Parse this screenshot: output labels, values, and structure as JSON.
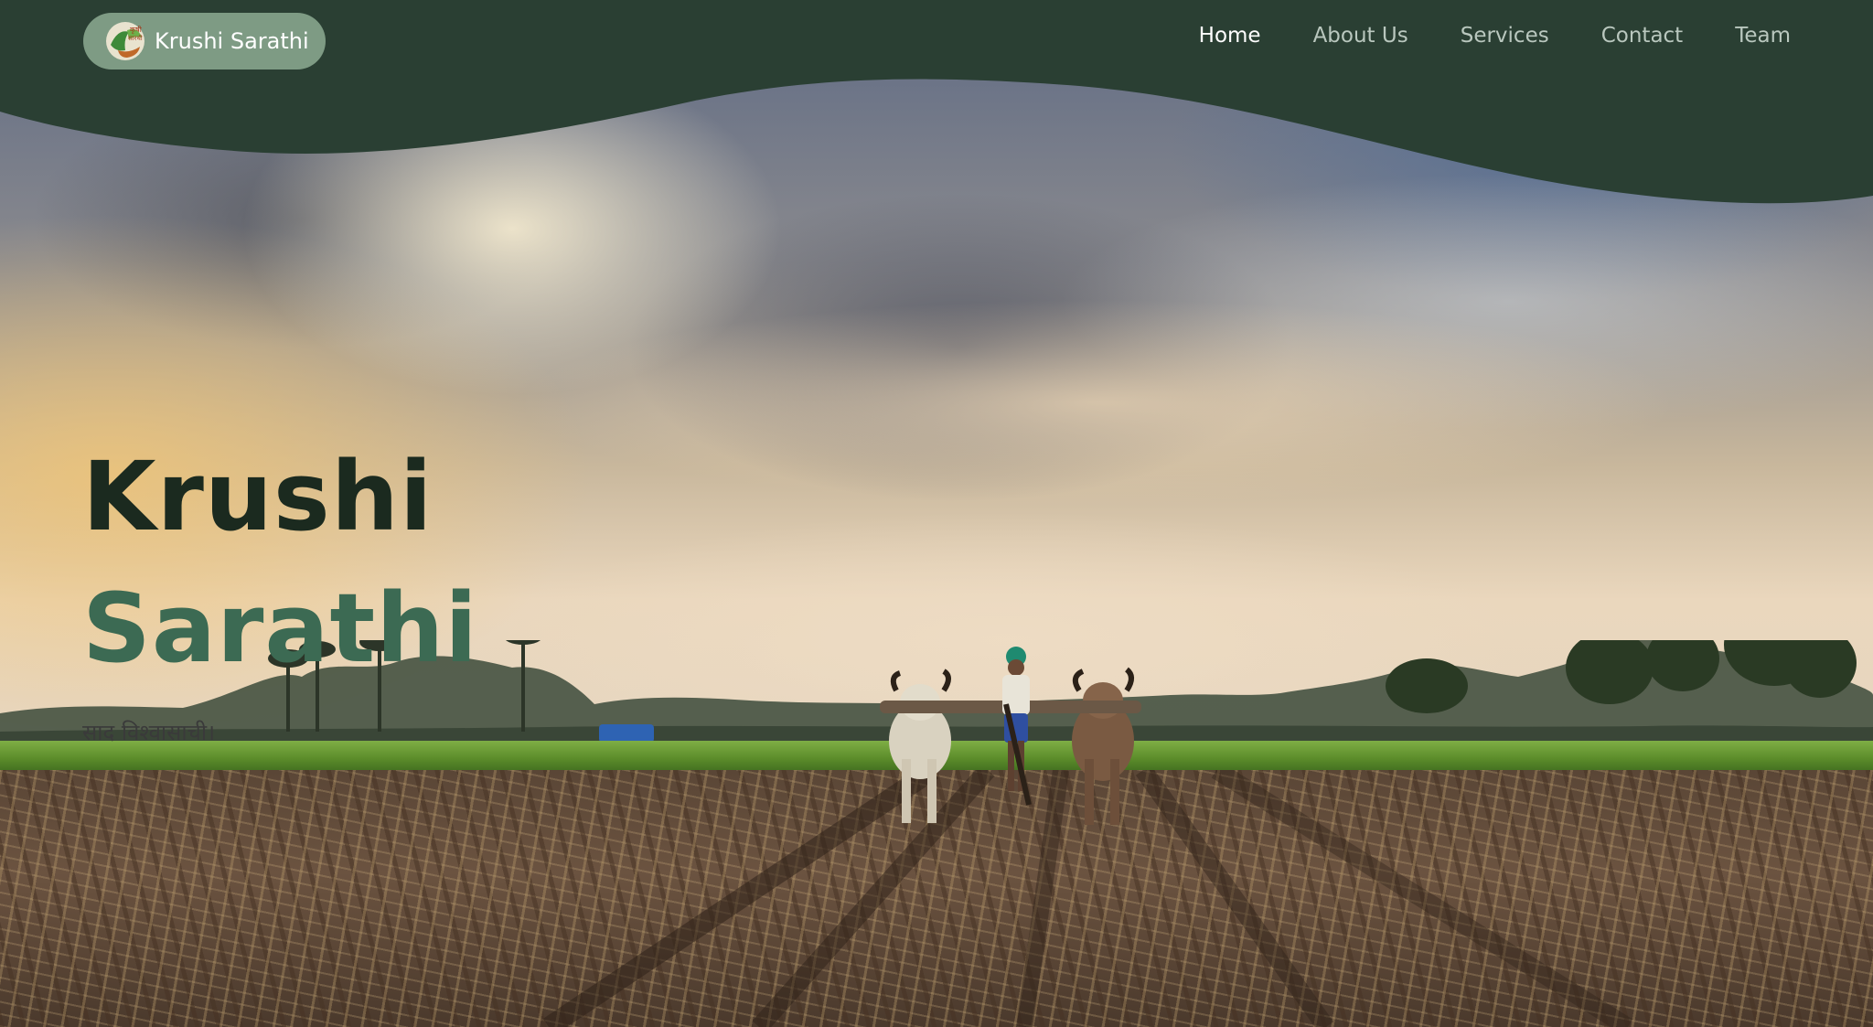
{
  "brand": {
    "name": "Krushi Sarathi",
    "logo_icon": "krushi-sarathi-logo-icon"
  },
  "nav": {
    "items": [
      {
        "label": "Home",
        "active": true
      },
      {
        "label": "About Us",
        "active": false
      },
      {
        "label": "Services",
        "active": false
      },
      {
        "label": "Contact",
        "active": false
      },
      {
        "label": "Team",
        "active": false
      }
    ]
  },
  "hero": {
    "title_line1": "Krushi",
    "title_line2": "Sarathi",
    "tagline": "साद विश्वासाची।"
  },
  "colors": {
    "header_bg": "#2a3f33",
    "brand_pill_bg": "#7e9b84",
    "title_dark": "#1b2a1f",
    "title_green": "#3c6a53",
    "nav_active": "#ffffff",
    "nav_inactive": "#b9c7be"
  }
}
